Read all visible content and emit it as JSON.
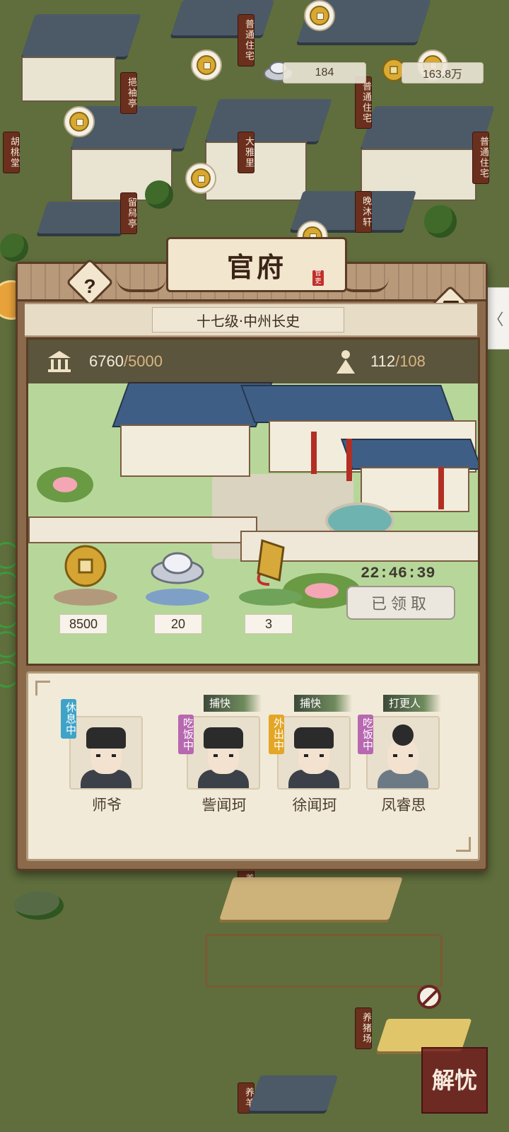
{
  "resources": {
    "silver": "184",
    "coins": "163.8万"
  },
  "map_labels": [
    "普通住宅",
    "挹袖亭",
    "胡桃堂",
    "大雅里",
    "留舄亭",
    "普通住宅",
    "晚沐轩",
    "普通住宅",
    "养马场",
    "养猪场",
    "养羊"
  ],
  "panel": {
    "title": "官府",
    "seal": "官吏",
    "help": "?",
    "rank": "十七级·中州长史",
    "prestige": {
      "current": "6760",
      "max": "/5000"
    },
    "population": {
      "current": "112",
      "max": "/108"
    },
    "rewards": [
      {
        "icon": "copper-coin-icon",
        "value": "8500"
      },
      {
        "icon": "silver-ingot-icon",
        "value": "20"
      },
      {
        "icon": "token-icon",
        "value": "3"
      }
    ],
    "timer": "22:46:39",
    "claim_label": "已领取"
  },
  "staff": [
    {
      "name": "师爷",
      "status": "休息中",
      "status_color": "#3fa3c8",
      "role": ""
    },
    {
      "name": "訾闻珂",
      "status": "吃饭中",
      "status_color": "#b768b0",
      "role": "捕快"
    },
    {
      "name": "徐闻珂",
      "status": "外出中",
      "status_color": "#e3a626",
      "role": "捕快"
    },
    {
      "name": "凤睿思",
      "status": "吃饭中",
      "status_color": "#b768b0",
      "role": "打更人"
    }
  ],
  "side_tab": "〈",
  "stamp_text": "解忧"
}
